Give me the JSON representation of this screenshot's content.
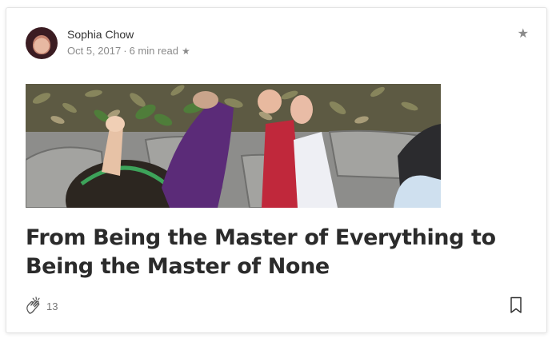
{
  "post": {
    "author": "Sophia Chow",
    "date": "Oct 5, 2017",
    "separator": "·",
    "read_time": "6 min read",
    "member_star": "★",
    "title": "From Being the Master of Everything to Being the Master of None",
    "claps": "13"
  },
  "icons": {
    "top_star": "★",
    "member_star": "star-icon",
    "clap": "clap-icon",
    "bookmark": "bookmark-icon"
  },
  "colors": {
    "title": "#2b2b2b",
    "meta": "#8a8a8a",
    "card_border": "#e4e4e4"
  }
}
